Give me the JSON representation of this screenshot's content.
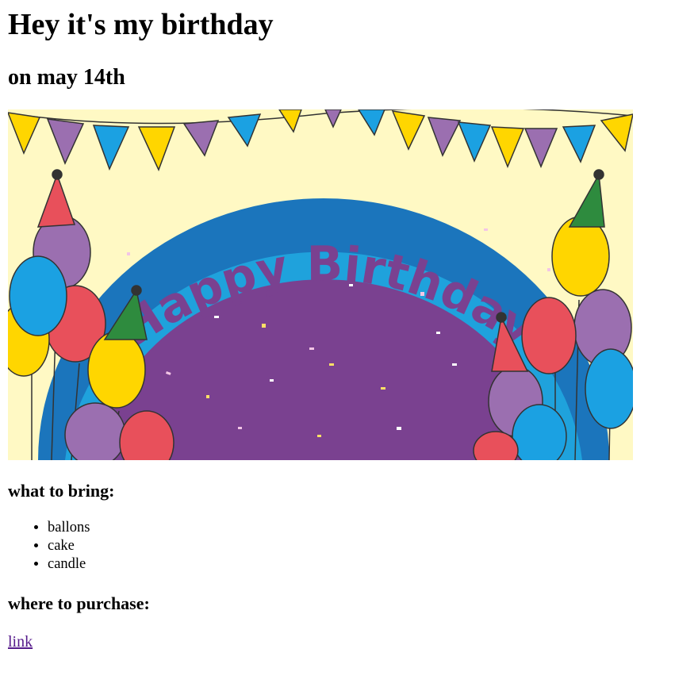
{
  "header": {
    "title": "Hey it's my birthday",
    "subtitle": "on may 14th"
  },
  "banner": {
    "text": "Happy Birthday",
    "colors": {
      "background": "#fff9c4",
      "rainbow_outer": "#1b75bc",
      "rainbow_middle": "#1fa2dc",
      "rainbow_inner": "#7a4190",
      "text": "#7a4190",
      "yellow": "#ffd600",
      "blue": "#1ba1e2",
      "purple": "#9b6fb0",
      "red": "#e8505b",
      "green": "#2e8b3e"
    }
  },
  "bring": {
    "heading": "what to bring:",
    "items": [
      "ballons",
      "cake",
      "candle"
    ]
  },
  "purchase": {
    "heading": "where to purchase:",
    "link_label": "link"
  }
}
